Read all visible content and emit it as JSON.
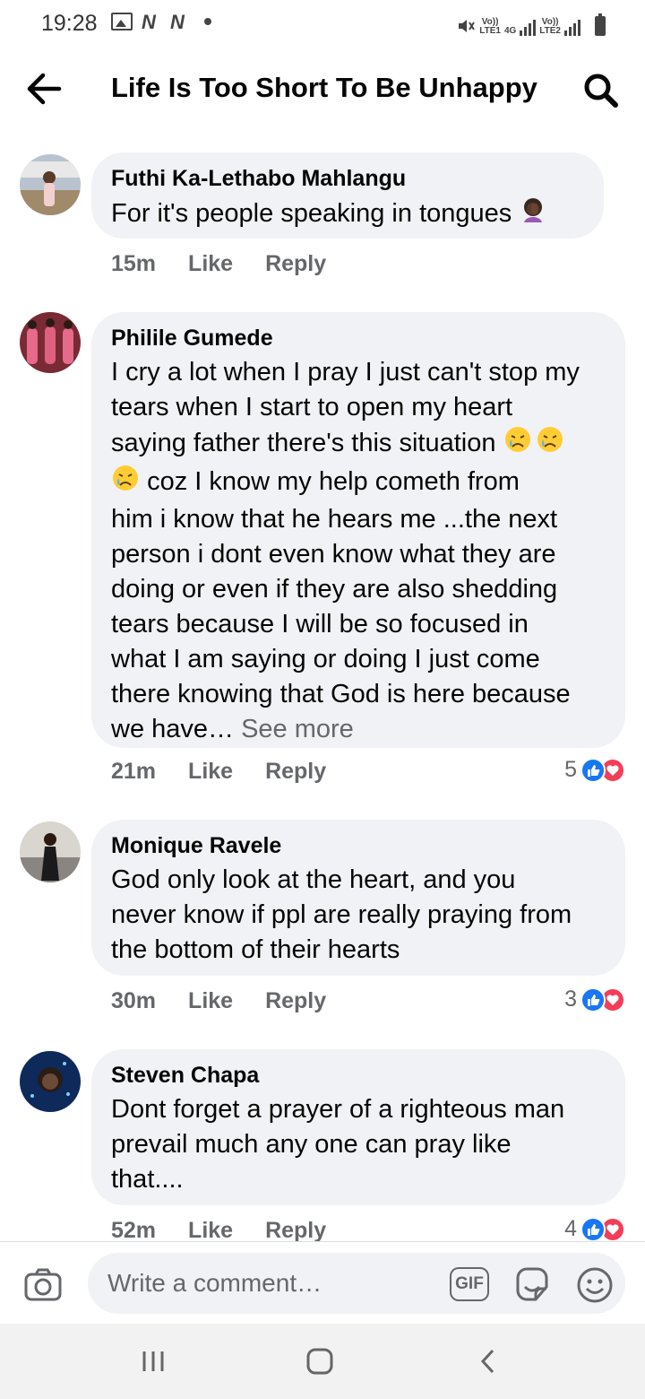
{
  "status_bar": {
    "time": "19:28",
    "network_1": "Vo)) LTE1",
    "network_type": "4G",
    "network_2": "Vo)) LTE2"
  },
  "header": {
    "title": "Life Is Too Short To Be Unhappy",
    "back_icon": "arrow-left-icon",
    "search_icon": "search-icon"
  },
  "comments": [
    {
      "author": "Futhi Ka-Lethabo Mahlangu",
      "text": "For it's people speaking in tongues",
      "emoji": "🤦🏿‍♀️",
      "time": "15m",
      "like_label": "Like",
      "reply_label": "Reply",
      "reaction_count": null
    },
    {
      "author": "Philile Gumede",
      "lines": [
        "I cry a lot when I pray I just can't stop my",
        "tears when I start to open my heart",
        "saying father there's this situation",
        "coz  I know my help cometh from",
        "him i know that he hears me ...the next",
        "person i dont even know what they are",
        "doing or even if they are also shedding",
        "tears because I will be so focused in",
        "what I am saying  or doing  I just come",
        "there knowing that God is here because",
        "we have…"
      ],
      "see_more": "See more",
      "time": "21m",
      "like_label": "Like",
      "reply_label": "Reply",
      "reaction_count": "5"
    },
    {
      "author": "Monique Ravele",
      "lines": [
        "God only look at the heart, and you",
        "never know if ppl are really praying from",
        "the bottom of their hearts"
      ],
      "time": "30m",
      "like_label": "Like",
      "reply_label": "Reply",
      "reaction_count": "3"
    },
    {
      "author": "Steven Chapa",
      "lines": [
        "Dont forget a prayer of a righteous man",
        "prevail much any one can pray like",
        "that...."
      ],
      "time": "52m",
      "like_label": "Like",
      "reply_label": "Reply",
      "reaction_count": "4"
    }
  ],
  "composer": {
    "placeholder": "Write a comment…",
    "gif_label": "GIF"
  },
  "colors": {
    "bubble": "#f0f2f5",
    "secondary_text": "#65676b",
    "like_blue": "#1877f2",
    "love_red": "#f33e58"
  }
}
